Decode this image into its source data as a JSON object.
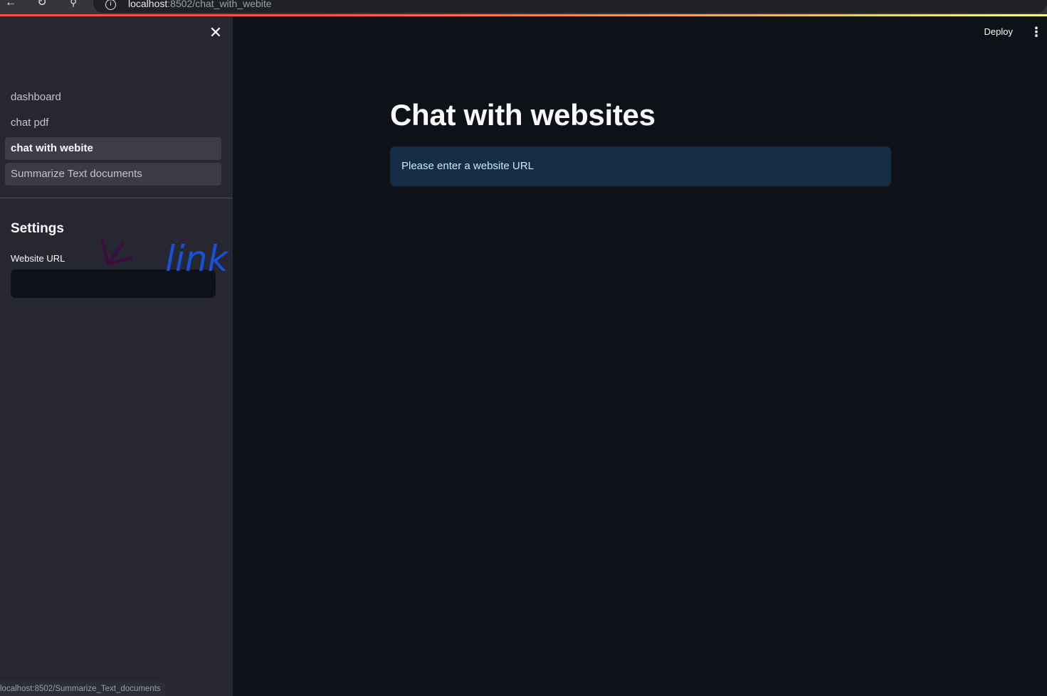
{
  "browser": {
    "url_host": "localhost",
    "url_rest": ":8502/chat_with_webite"
  },
  "sidebar": {
    "close_symbol": "✕",
    "nav_items": [
      {
        "label": "dashboard"
      },
      {
        "label": "chat pdf"
      },
      {
        "label": "chat with webite"
      },
      {
        "label": "Summarize Text documents"
      }
    ],
    "settings_title": "Settings",
    "url_label": "Website URL",
    "url_value": "",
    "annotation_text": "link"
  },
  "header": {
    "deploy_label": "Deploy",
    "menu_symbol": "⋮"
  },
  "main": {
    "title": "Chat with websites",
    "info_message": "Please enter a website URL"
  },
  "status_bar": {
    "hover_url": "localhost:8502/Summarize_Text_documents"
  },
  "colors": {
    "app_bg": "#0e1117",
    "sidebar_bg": "#262730",
    "info_bg": "#172d43",
    "info_text": "#c7ebff",
    "annotation_arrow": "#3a0f3f",
    "annotation_text": "#1a4fd8"
  }
}
